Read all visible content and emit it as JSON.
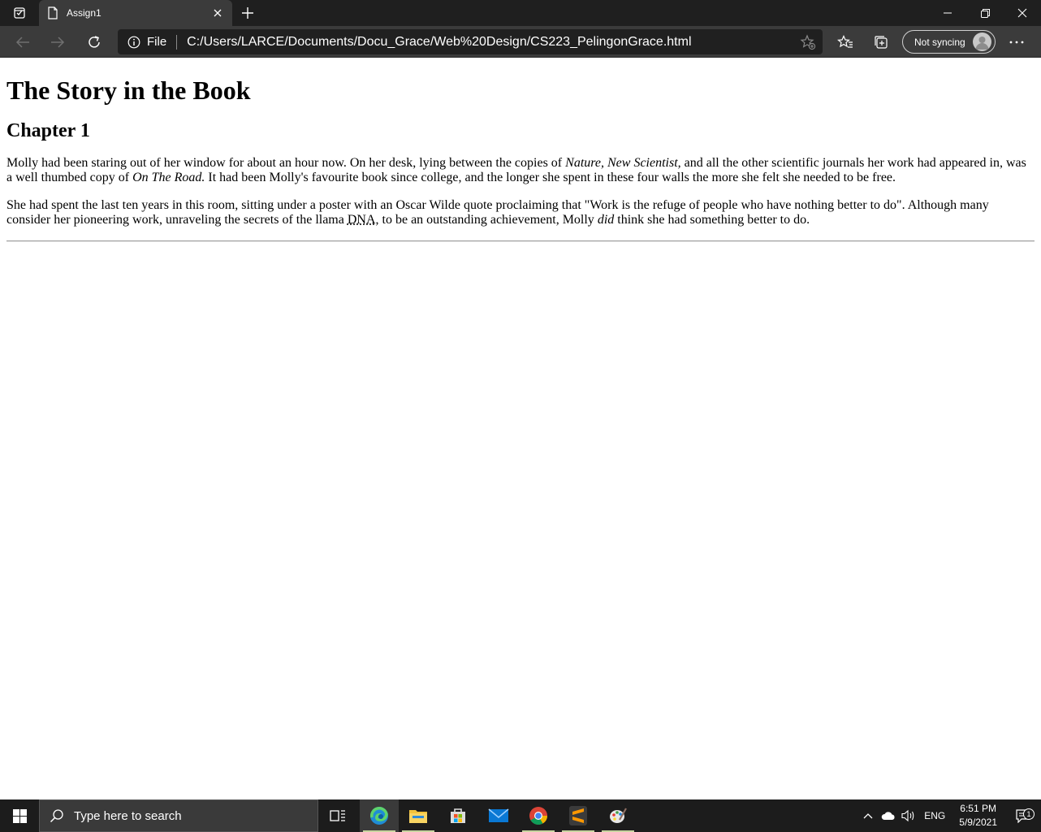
{
  "browser": {
    "tab": {
      "title": "Assign1"
    },
    "address": {
      "scheme_label": "File",
      "url": "C:/Users/LARCE/Documents/Docu_Grace/Web%20Design/CS223_PelingonGrace.html"
    },
    "sync": {
      "label": "Not syncing"
    }
  },
  "page": {
    "heading": "The Story in the Book",
    "chapter": "Chapter 1",
    "p1": {
      "t1": "Molly had been staring out of her window for about an hour now. On her desk, lying between the copies of ",
      "em1": "Nature, New Scientist,",
      "t2": " and all the other scientific journals her work had appeared in, was a well thumbed copy of ",
      "em2": "On The Road.",
      "t3": " It had been Molly's favourite book since college, and the longer she spent in these four walls the more she felt she needed to be free."
    },
    "p2": {
      "t1": "She had spent the last ten years in this room, sitting under a poster with an Oscar Wilde quote proclaiming that \"Work is the refuge of people who have nothing better to do\". Although many consider her pioneering work, unraveling the secrets of the llama ",
      "abbr": "DNA",
      "t2": ", to be an outstanding achievement, Molly ",
      "em": "did",
      "t3": " think she had something better to do."
    }
  },
  "taskbar": {
    "search_placeholder": "Type here to search",
    "language": "ENG",
    "time": "6:51 PM",
    "date": "5/9/2021",
    "notification_count": "1"
  },
  "icons": {
    "tab_actions": "tab-actions-icon",
    "page": "page-icon",
    "close": "close-icon",
    "new_tab": "plus-icon",
    "minimize": "minimize-icon",
    "restore": "restore-icon",
    "window_close": "close-icon",
    "back": "back-arrow-icon",
    "forward": "forward-arrow-icon",
    "refresh": "refresh-icon",
    "info": "info-icon",
    "add_favorite": "star-add-icon",
    "favorites": "favorites-icon",
    "collections": "collections-icon",
    "more": "more-icon"
  }
}
